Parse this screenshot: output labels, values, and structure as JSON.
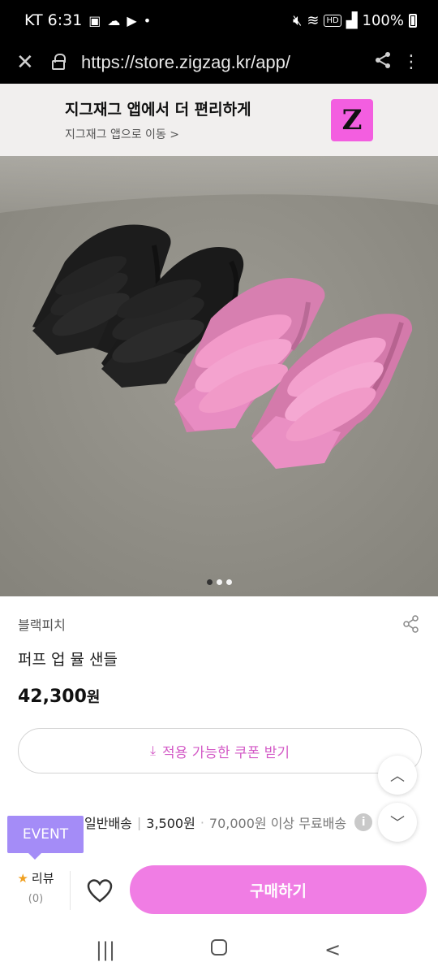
{
  "status_bar": {
    "carrier_time": "KT 6:31",
    "hd": "HD",
    "signal": "ᵢₗ",
    "battery": "100%"
  },
  "browser": {
    "url": "https://store.zigzag.kr/app/"
  },
  "app_banner": {
    "title": "지그재그 앱에서 더 편리하게",
    "subtitle": "지그재그 앱으로 이동 >",
    "logo_letter": "Z",
    "logo_color": "#f35ee0"
  },
  "product": {
    "image_pages": 3,
    "current_page": 1,
    "brand": "블랙피치",
    "name": "퍼프 업 뮬 샌들",
    "price": "42,300",
    "price_unit": "원"
  },
  "coupon": {
    "label": "적용 가능한 쿠폰 받기",
    "color": "#d35ac6"
  },
  "shipping": {
    "type": "일반배송",
    "fee": "3,500원",
    "free_condition": "70,000원 이상 무료배송"
  },
  "event_badge": {
    "label": "EVENT",
    "color": "#a48cf7"
  },
  "bottom_bar": {
    "review_label": "리뷰",
    "review_count": "(0)",
    "buy_label": "구매하기",
    "buy_color": "#f07de4"
  },
  "nav_bar": {
    "recents": "|||",
    "home": "○",
    "back": "<"
  }
}
